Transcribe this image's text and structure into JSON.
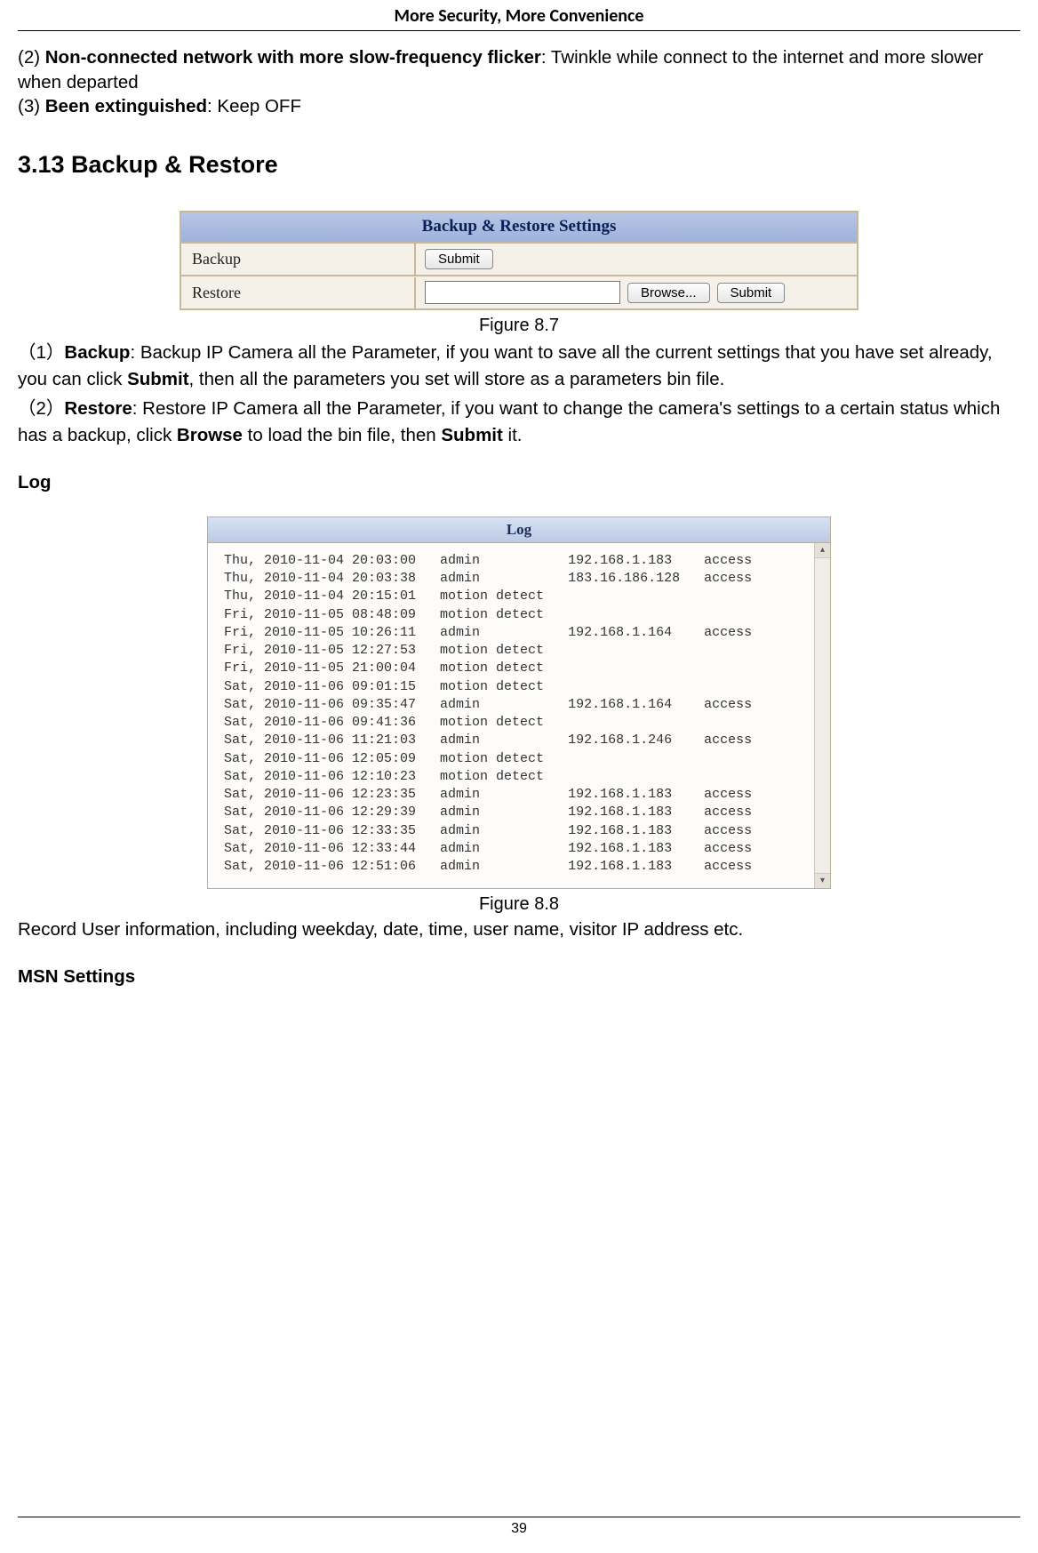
{
  "header": {
    "title": "More Security, More Convenience"
  },
  "intro": {
    "item2_prefix": "(2) ",
    "item2_bold": "Non-connected network with more slow-frequency flicker",
    "item2_rest": ": Twinkle while connect to the internet and more slower when departed",
    "item3_prefix": "(3) ",
    "item3_bold": "Been extinguished",
    "item3_rest": ": Keep OFF"
  },
  "section": {
    "heading": "3.13 Backup & Restore"
  },
  "backup_fig": {
    "title": "Backup & Restore Settings",
    "row1_label": "Backup",
    "row1_btn": "Submit",
    "row2_label": "Restore",
    "row2_input_value": "",
    "row2_browse": "Browse...",
    "row2_submit": "Submit",
    "caption": "Figure 8.7"
  },
  "para": {
    "p1_pre": "（1）",
    "p1_b1": "Backup",
    "p1_mid1": ": Backup IP Camera all the Parameter, if you want to save all the current settings that you have set already, you can click ",
    "p1_b2": "Submit",
    "p1_mid2": ", then all the parameters you set will store as a parameters bin file.",
    "p2_pre": "（2）",
    "p2_b1": "Restore",
    "p2_mid1": ": Restore IP Camera all the Parameter, if you want to change the camera's settings to a certain status which has a backup, click ",
    "p2_b2": "Browse",
    "p2_mid2": " to load the bin file, then ",
    "p2_b3": "Submit",
    "p2_mid3": " it."
  },
  "log_section": {
    "heading": "Log",
    "title": "Log",
    "caption": "Figure 8.8",
    "after_text": "Record User information, including weekday, date, time, user name, visitor IP address etc.",
    "rows": [
      {
        "day": "Thu,",
        "date": "2010-11-04",
        "time": "20:03:00",
        "user": "admin",
        "ip": "192.168.1.183",
        "action": "access"
      },
      {
        "day": "Thu,",
        "date": "2010-11-04",
        "time": "20:03:38",
        "user": "admin",
        "ip": "183.16.186.128",
        "action": "access"
      },
      {
        "day": "Thu,",
        "date": "2010-11-04",
        "time": "20:15:01",
        "user": "motion detect",
        "ip": "",
        "action": ""
      },
      {
        "day": "Fri,",
        "date": "2010-11-05",
        "time": "08:48:09",
        "user": "motion detect",
        "ip": "",
        "action": ""
      },
      {
        "day": "Fri,",
        "date": "2010-11-05",
        "time": "10:26:11",
        "user": "admin",
        "ip": "192.168.1.164",
        "action": "access"
      },
      {
        "day": "Fri,",
        "date": "2010-11-05",
        "time": "12:27:53",
        "user": "motion detect",
        "ip": "",
        "action": ""
      },
      {
        "day": "Fri,",
        "date": "2010-11-05",
        "time": "21:00:04",
        "user": "motion detect",
        "ip": "",
        "action": ""
      },
      {
        "day": "Sat,",
        "date": "2010-11-06",
        "time": "09:01:15",
        "user": "motion detect",
        "ip": "",
        "action": ""
      },
      {
        "day": "Sat,",
        "date": "2010-11-06",
        "time": "09:35:47",
        "user": "admin",
        "ip": "192.168.1.164",
        "action": "access"
      },
      {
        "day": "Sat,",
        "date": "2010-11-06",
        "time": "09:41:36",
        "user": "motion detect",
        "ip": "",
        "action": ""
      },
      {
        "day": "Sat,",
        "date": "2010-11-06",
        "time": "11:21:03",
        "user": "admin",
        "ip": "192.168.1.246",
        "action": "access"
      },
      {
        "day": "Sat,",
        "date": "2010-11-06",
        "time": "12:05:09",
        "user": "motion detect",
        "ip": "",
        "action": ""
      },
      {
        "day": "Sat,",
        "date": "2010-11-06",
        "time": "12:10:23",
        "user": "motion detect",
        "ip": "",
        "action": ""
      },
      {
        "day": "Sat,",
        "date": "2010-11-06",
        "time": "12:23:35",
        "user": "admin",
        "ip": "192.168.1.183",
        "action": "access"
      },
      {
        "day": "Sat,",
        "date": "2010-11-06",
        "time": "12:29:39",
        "user": "admin",
        "ip": "192.168.1.183",
        "action": "access"
      },
      {
        "day": "Sat,",
        "date": "2010-11-06",
        "time": "12:33:35",
        "user": "admin",
        "ip": "192.168.1.183",
        "action": "access"
      },
      {
        "day": "Sat,",
        "date": "2010-11-06",
        "time": "12:33:44",
        "user": "admin",
        "ip": "192.168.1.183",
        "action": "access"
      },
      {
        "day": "Sat,",
        "date": "2010-11-06",
        "time": "12:51:06",
        "user": "admin",
        "ip": "192.168.1.183",
        "action": "access"
      }
    ]
  },
  "msn": {
    "heading": "MSN Settings"
  },
  "footer": {
    "page_number": "39"
  }
}
